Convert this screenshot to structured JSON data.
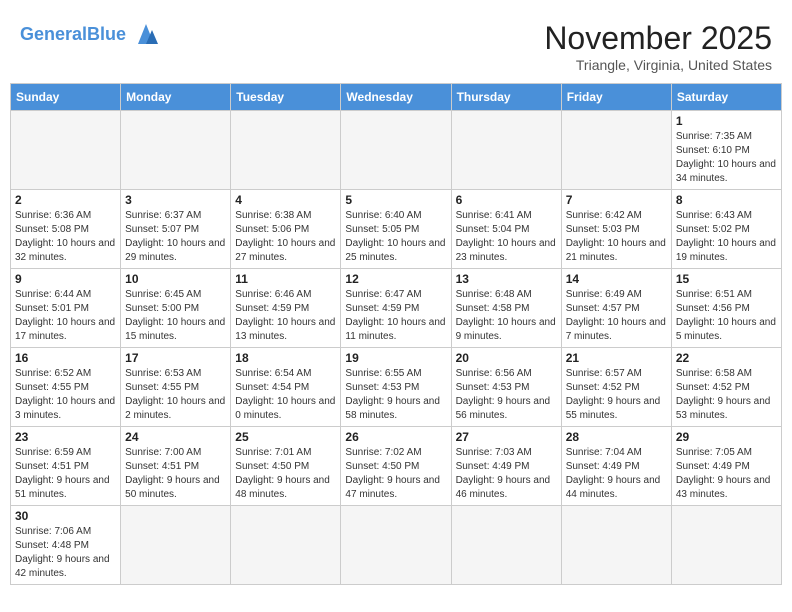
{
  "header": {
    "logo_general": "General",
    "logo_blue": "Blue",
    "month_title": "November 2025",
    "location": "Triangle, Virginia, United States"
  },
  "days_of_week": [
    "Sunday",
    "Monday",
    "Tuesday",
    "Wednesday",
    "Thursday",
    "Friday",
    "Saturday"
  ],
  "weeks": [
    [
      {
        "day": "",
        "info": ""
      },
      {
        "day": "",
        "info": ""
      },
      {
        "day": "",
        "info": ""
      },
      {
        "day": "",
        "info": ""
      },
      {
        "day": "",
        "info": ""
      },
      {
        "day": "",
        "info": ""
      },
      {
        "day": "1",
        "info": "Sunrise: 7:35 AM\nSunset: 6:10 PM\nDaylight: 10 hours and 34 minutes."
      }
    ],
    [
      {
        "day": "2",
        "info": "Sunrise: 6:36 AM\nSunset: 5:08 PM\nDaylight: 10 hours and 32 minutes."
      },
      {
        "day": "3",
        "info": "Sunrise: 6:37 AM\nSunset: 5:07 PM\nDaylight: 10 hours and 29 minutes."
      },
      {
        "day": "4",
        "info": "Sunrise: 6:38 AM\nSunset: 5:06 PM\nDaylight: 10 hours and 27 minutes."
      },
      {
        "day": "5",
        "info": "Sunrise: 6:40 AM\nSunset: 5:05 PM\nDaylight: 10 hours and 25 minutes."
      },
      {
        "day": "6",
        "info": "Sunrise: 6:41 AM\nSunset: 5:04 PM\nDaylight: 10 hours and 23 minutes."
      },
      {
        "day": "7",
        "info": "Sunrise: 6:42 AM\nSunset: 5:03 PM\nDaylight: 10 hours and 21 minutes."
      },
      {
        "day": "8",
        "info": "Sunrise: 6:43 AM\nSunset: 5:02 PM\nDaylight: 10 hours and 19 minutes."
      }
    ],
    [
      {
        "day": "9",
        "info": "Sunrise: 6:44 AM\nSunset: 5:01 PM\nDaylight: 10 hours and 17 minutes."
      },
      {
        "day": "10",
        "info": "Sunrise: 6:45 AM\nSunset: 5:00 PM\nDaylight: 10 hours and 15 minutes."
      },
      {
        "day": "11",
        "info": "Sunrise: 6:46 AM\nSunset: 4:59 PM\nDaylight: 10 hours and 13 minutes."
      },
      {
        "day": "12",
        "info": "Sunrise: 6:47 AM\nSunset: 4:59 PM\nDaylight: 10 hours and 11 minutes."
      },
      {
        "day": "13",
        "info": "Sunrise: 6:48 AM\nSunset: 4:58 PM\nDaylight: 10 hours and 9 minutes."
      },
      {
        "day": "14",
        "info": "Sunrise: 6:49 AM\nSunset: 4:57 PM\nDaylight: 10 hours and 7 minutes."
      },
      {
        "day": "15",
        "info": "Sunrise: 6:51 AM\nSunset: 4:56 PM\nDaylight: 10 hours and 5 minutes."
      }
    ],
    [
      {
        "day": "16",
        "info": "Sunrise: 6:52 AM\nSunset: 4:55 PM\nDaylight: 10 hours and 3 minutes."
      },
      {
        "day": "17",
        "info": "Sunrise: 6:53 AM\nSunset: 4:55 PM\nDaylight: 10 hours and 2 minutes."
      },
      {
        "day": "18",
        "info": "Sunrise: 6:54 AM\nSunset: 4:54 PM\nDaylight: 10 hours and 0 minutes."
      },
      {
        "day": "19",
        "info": "Sunrise: 6:55 AM\nSunset: 4:53 PM\nDaylight: 9 hours and 58 minutes."
      },
      {
        "day": "20",
        "info": "Sunrise: 6:56 AM\nSunset: 4:53 PM\nDaylight: 9 hours and 56 minutes."
      },
      {
        "day": "21",
        "info": "Sunrise: 6:57 AM\nSunset: 4:52 PM\nDaylight: 9 hours and 55 minutes."
      },
      {
        "day": "22",
        "info": "Sunrise: 6:58 AM\nSunset: 4:52 PM\nDaylight: 9 hours and 53 minutes."
      }
    ],
    [
      {
        "day": "23",
        "info": "Sunrise: 6:59 AM\nSunset: 4:51 PM\nDaylight: 9 hours and 51 minutes."
      },
      {
        "day": "24",
        "info": "Sunrise: 7:00 AM\nSunset: 4:51 PM\nDaylight: 9 hours and 50 minutes."
      },
      {
        "day": "25",
        "info": "Sunrise: 7:01 AM\nSunset: 4:50 PM\nDaylight: 9 hours and 48 minutes."
      },
      {
        "day": "26",
        "info": "Sunrise: 7:02 AM\nSunset: 4:50 PM\nDaylight: 9 hours and 47 minutes."
      },
      {
        "day": "27",
        "info": "Sunrise: 7:03 AM\nSunset: 4:49 PM\nDaylight: 9 hours and 46 minutes."
      },
      {
        "day": "28",
        "info": "Sunrise: 7:04 AM\nSunset: 4:49 PM\nDaylight: 9 hours and 44 minutes."
      },
      {
        "day": "29",
        "info": "Sunrise: 7:05 AM\nSunset: 4:49 PM\nDaylight: 9 hours and 43 minutes."
      }
    ],
    [
      {
        "day": "30",
        "info": "Sunrise: 7:06 AM\nSunset: 4:48 PM\nDaylight: 9 hours and 42 minutes."
      },
      {
        "day": "",
        "info": ""
      },
      {
        "day": "",
        "info": ""
      },
      {
        "day": "",
        "info": ""
      },
      {
        "day": "",
        "info": ""
      },
      {
        "day": "",
        "info": ""
      },
      {
        "day": "",
        "info": ""
      }
    ]
  ]
}
